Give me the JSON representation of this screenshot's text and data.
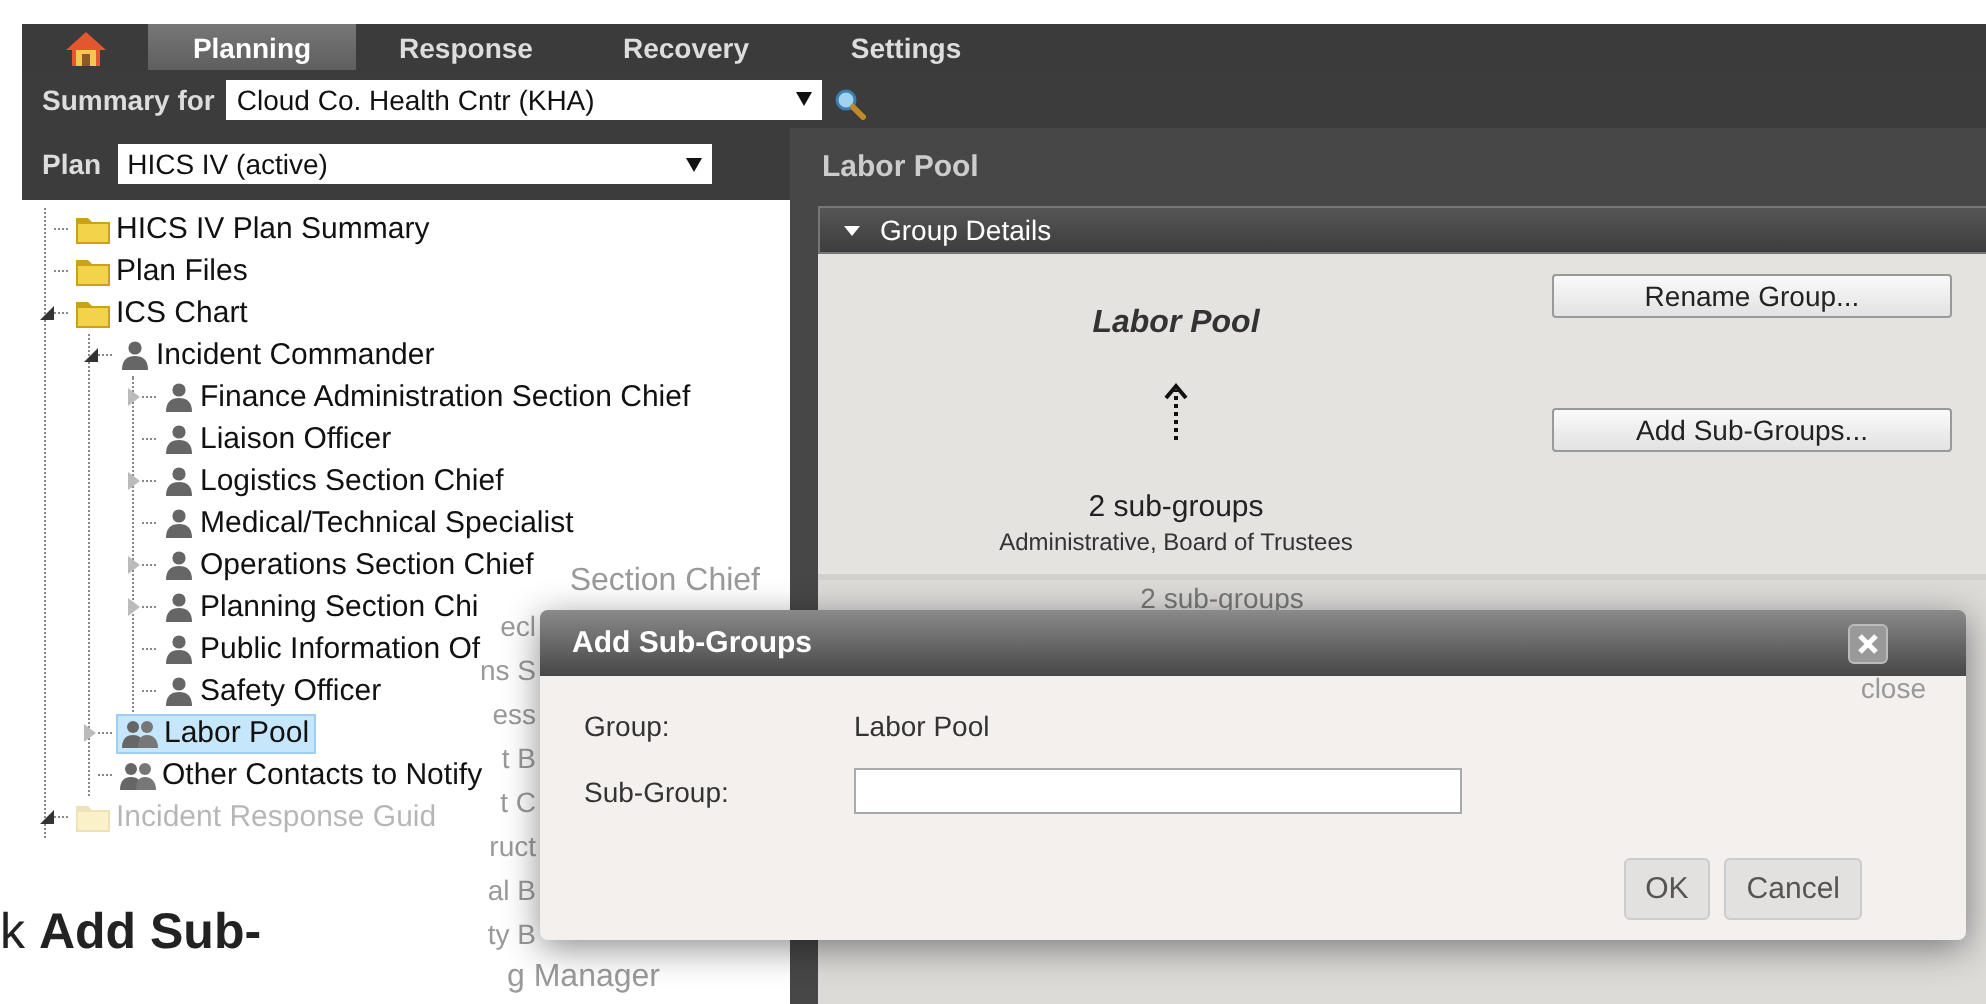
{
  "nav": {
    "tabs": [
      {
        "kind": "home",
        "selected": false
      },
      {
        "kind": "text",
        "label": "Planning",
        "selected": true
      },
      {
        "kind": "text",
        "label": "Response",
        "selected": false
      },
      {
        "kind": "text",
        "label": "Recovery",
        "selected": false
      },
      {
        "kind": "text",
        "label": "Settings",
        "selected": false
      }
    ]
  },
  "summary": {
    "label": "Summary for",
    "value": "Cloud Co. Health Cntr (KHA)"
  },
  "plan": {
    "label": "Plan",
    "value": "HICS IV (active)"
  },
  "tree": [
    {
      "label": "HICS IV Plan Summary",
      "kind": "folder",
      "selected": false,
      "dimmed": false
    },
    {
      "label": "Plan Files",
      "kind": "folder",
      "selected": false,
      "dimmed": false
    },
    {
      "label": "ICS Chart",
      "kind": "folder",
      "expanded": true,
      "selected": false,
      "dimmed": false,
      "children": [
        {
          "label": "Incident Commander",
          "kind": "person",
          "expanded": true,
          "selected": false,
          "dimmed": false,
          "children": [
            {
              "label": "Finance Administration Section Chief",
              "kind": "person",
              "expanded": false,
              "selected": false,
              "dimmed": false
            },
            {
              "label": "Liaison Officer",
              "kind": "person",
              "selected": false,
              "dimmed": false
            },
            {
              "label": "Logistics Section Chief",
              "kind": "person",
              "expanded": false,
              "selected": false,
              "dimmed": false
            },
            {
              "label": "Medical/Technical Specialist",
              "kind": "person",
              "selected": false,
              "dimmed": false
            },
            {
              "label": "Operations Section Chief",
              "kind": "person",
              "expanded": false,
              "selected": false,
              "dimmed": false
            },
            {
              "label": "Planning Section Chi",
              "kind": "person",
              "expanded": false,
              "selected": false,
              "dimmed": false
            },
            {
              "label": "Public Information Of",
              "kind": "person",
              "selected": false,
              "dimmed": false
            },
            {
              "label": "Safety Officer",
              "kind": "person",
              "selected": false,
              "dimmed": false
            }
          ]
        },
        {
          "label": "Labor Pool",
          "kind": "group",
          "expanded": false,
          "selected": true,
          "dimmed": false
        },
        {
          "label": "Other Contacts to Notify",
          "kind": "group",
          "selected": false,
          "dimmed": false
        }
      ]
    },
    {
      "label": "Incident Response Guid",
      "kind": "folder",
      "expanded": true,
      "selected": false,
      "dimmed": true
    }
  ],
  "detail": {
    "title": "Labor Pool",
    "section": {
      "title": "Group Details",
      "expanded": true
    },
    "group_name": "Labor Pool",
    "subgroup_count": "2 sub-groups",
    "subgroup_names": "Administrative, Board of Trustees",
    "buttons": [
      "Rename Group...",
      "Add Sub-Groups..."
    ],
    "next_section_text": "2 sub-groups"
  },
  "ghost_text": [
    "Section Chief",
    "ecl",
    "ns S",
    "ess",
    "t B",
    "t C",
    "ruct",
    "al B",
    "ty B",
    "g Manager"
  ],
  "close_hint": "close",
  "dialog": {
    "title": "Add Sub-Groups",
    "fields": [
      {
        "label": "Group:",
        "kind": "text",
        "value": "Labor Pool"
      },
      {
        "label": "Sub-Group:",
        "kind": "input"
      }
    ],
    "buttons": [
      "OK",
      "Cancel"
    ]
  },
  "caption": "k **Add Sub-**"
}
